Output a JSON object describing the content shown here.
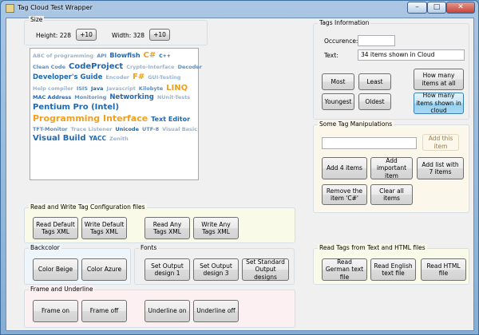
{
  "window": {
    "title": "Tag Cloud Test Wrapper",
    "minimize": "–",
    "maximize": "□",
    "close": "✕"
  },
  "size": {
    "label": "Size",
    "height_label": "Height: 228",
    "height_button": "+10",
    "width_label": "Width: 328",
    "width_button": "+10"
  },
  "tag_colors": {
    "light": "#9ab3cc",
    "medium": "#5d8bbf",
    "dark": "#1f67b1",
    "orange": "#f0a020"
  },
  "cloud": {
    "rows": [
      [
        {
          "text": "ABC of programming",
          "size": 6.5,
          "color": "light"
        },
        {
          "text": "API",
          "size": 6.5,
          "color": "medium"
        },
        {
          "text": "Blowfish",
          "size": 8,
          "color": "dark"
        },
        {
          "text": "C#",
          "size": 10,
          "color": "orange"
        },
        {
          "text": "C++",
          "size": 6,
          "color": "dark"
        }
      ],
      [
        {
          "text": "Clean Code",
          "size": 6.5,
          "color": "medium"
        },
        {
          "text": "CodeProject",
          "size": 10,
          "color": "dark"
        },
        {
          "text": "Crypto-Interface",
          "size": 6.5,
          "color": "light"
        },
        {
          "text": "Decoder",
          "size": 6.5,
          "color": "medium"
        }
      ],
      [
        {
          "text": "Developer's Guide",
          "size": 8.5,
          "color": "dark"
        },
        {
          "text": "Encoder",
          "size": 6.5,
          "color": "light"
        },
        {
          "text": "F#",
          "size": 10,
          "color": "orange"
        },
        {
          "text": "GUI-Testing",
          "size": 6.5,
          "color": "light"
        }
      ],
      [
        {
          "text": "Help compiler",
          "size": 6.5,
          "color": "light"
        },
        {
          "text": "ISIS",
          "size": 6.5,
          "color": "medium"
        },
        {
          "text": "Java",
          "size": 6.5,
          "color": "dark"
        },
        {
          "text": "Javascript",
          "size": 6.5,
          "color": "light"
        },
        {
          "text": "Kilobyte",
          "size": 6.5,
          "color": "medium"
        },
        {
          "text": "LINQ",
          "size": 10,
          "color": "orange"
        }
      ],
      [
        {
          "text": "MAC Address",
          "size": 6.5,
          "color": "dark"
        },
        {
          "text": "Monitoring",
          "size": 6.5,
          "color": "medium"
        },
        {
          "text": "Networking",
          "size": 8.5,
          "color": "dark"
        },
        {
          "text": "NUnit-Tests",
          "size": 6.5,
          "color": "light"
        }
      ],
      [
        {
          "text": "Pentium Pro (Intel)",
          "size": 10,
          "color": "dark"
        }
      ],
      [
        {
          "text": "Programming Interface",
          "size": 11,
          "color": "orange"
        },
        {
          "text": "Text Editor",
          "size": 8,
          "color": "dark"
        }
      ],
      [
        {
          "text": "TFT-Monitor",
          "size": 6.5,
          "color": "medium"
        },
        {
          "text": "Trace Listener",
          "size": 6.5,
          "color": "light"
        },
        {
          "text": "Unicode",
          "size": 6.5,
          "color": "dark"
        },
        {
          "text": "UTF-8",
          "size": 6.5,
          "color": "medium"
        },
        {
          "text": "Visual Basic",
          "size": 6.5,
          "color": "light"
        }
      ],
      [
        {
          "text": "Visual Build",
          "size": 10,
          "color": "dark"
        },
        {
          "text": "YACC",
          "size": 7.5,
          "color": "dark"
        },
        {
          "text": "Zenith",
          "size": 6.5,
          "color": "light"
        }
      ]
    ]
  },
  "tags_info": {
    "label": "Tags Information",
    "occurence_label": "Occurence:",
    "occurence_value": "",
    "text_label": "Text:",
    "text_value": "34 items shown in Cloud",
    "buttons": {
      "most": "Most",
      "least": "Least",
      "how_many_all": "How many items at all",
      "youngest": "Youngest",
      "oldest": "Oldest",
      "how_many_cloud": "How many items shown in cloud"
    }
  },
  "manip": {
    "label": "Some Tag Manipulations",
    "input_value": "",
    "add_this_item": "Add this item",
    "add_4": "Add 4 items",
    "add_important": "Add important item",
    "add_list": "Add list with 7 items",
    "remove_cs": "Remove the item 'C#'",
    "clear_all": "Clear all items"
  },
  "config": {
    "label": "Read and Write Tag Configuration files",
    "read_default": "Read Default Tags XML",
    "write_default": "Write Default Tags XML",
    "read_any": "Read Any Tags XML",
    "write_any": "Write Any Tags XML"
  },
  "backcolor": {
    "label": "Backcolor",
    "beige": "Color Beige",
    "azure": "Color Azure"
  },
  "fonts": {
    "label": "Fonts",
    "design1": "Set Output design 1",
    "design3": "Set Output design 3",
    "standard": "Set Standard Output designs"
  },
  "frame": {
    "label": "Frame and Underline",
    "frame_on": "Frame on",
    "frame_off": "Frame off",
    "underline_on": "Underline on",
    "underline_off": "Underline off"
  },
  "read_tags": {
    "label": "Read Tags from Text and HTML files",
    "german": "Read German text file",
    "english": "Read English text file",
    "html": "Read HTML file"
  }
}
